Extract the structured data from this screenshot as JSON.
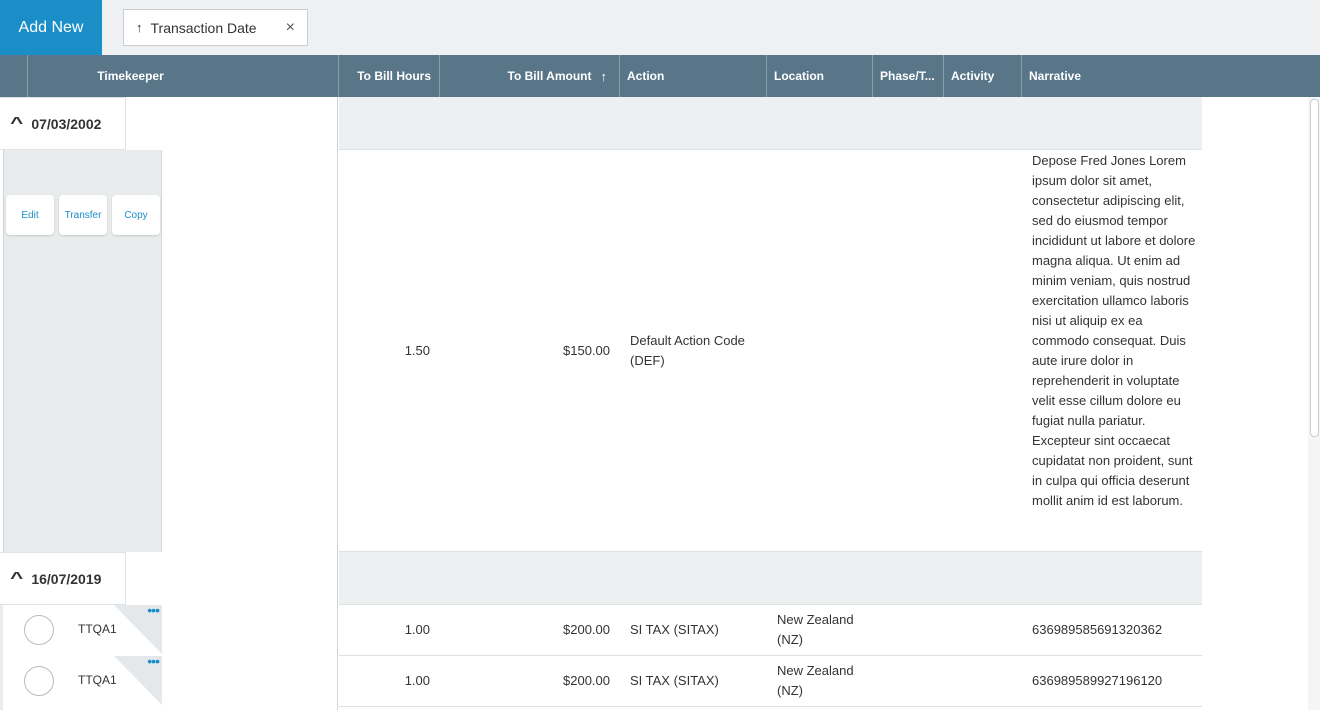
{
  "toolbar": {
    "add_new_label": "Add New",
    "sort_chip": {
      "arrow": "↑",
      "label": "Transaction Date",
      "close": "×"
    }
  },
  "columns": {
    "timekeeper": "Timekeeper",
    "to_bill_hours": "To Bill Hours",
    "to_bill_amount": "To Bill Amount",
    "to_bill_amount_sort": "↑",
    "action": "Action",
    "location": "Location",
    "phase": "Phase/T...",
    "activity": "Activity",
    "narrative": "Narrative"
  },
  "groups": [
    {
      "date": "07/03/2002",
      "row_actions": {
        "edit": "Edit",
        "transfer": "Transfer",
        "copy": "Copy"
      },
      "rows": [
        {
          "hours": "1.50",
          "amount": "$150.00",
          "action": "Default Action Code (DEF)",
          "location": "",
          "phase": "",
          "activity": "",
          "narrative": "Depose Fred Jones Lorem ipsum dolor sit amet, consectetur adipiscing elit, sed do eiusmod tempor incididunt ut labore et dolore magna aliqua. Ut enim ad minim veniam, quis nostrud exercitation ullamco laboris nisi ut aliquip ex ea commodo consequat. Duis aute irure dolor in reprehenderit in voluptate velit esse cillum dolore eu fugiat nulla pariatur. Excepteur sint occaecat cupidatat non proident, sunt in culpa qui officia deserunt mollit anim id est laborum."
        }
      ]
    },
    {
      "date": "16/07/2019",
      "rows": [
        {
          "timekeeper": "TTQA1",
          "more": "•••",
          "hours": "1.00",
          "amount": "$200.00",
          "action": "SI TAX (SITAX)",
          "location": "New Zealand (NZ)",
          "phase": "",
          "activity": "",
          "narrative": "636989585691320362"
        },
        {
          "timekeeper": "TTQA1",
          "more": "•••",
          "hours": "1.00",
          "amount": "$200.00",
          "action": "SI TAX (SITAX)",
          "location": "New Zealand (NZ)",
          "phase": "",
          "activity": "",
          "narrative": "636989589927196120"
        }
      ]
    }
  ],
  "colors": {
    "accent": "#1b8ec8",
    "header_bg": "#587688",
    "group_band": "#edf0f1"
  },
  "icons": {
    "sort_ascending": "arrow-up-icon",
    "collapse": "chevron-up-icon",
    "remove_sort": "close-icon",
    "more": "ellipsis-icon"
  }
}
